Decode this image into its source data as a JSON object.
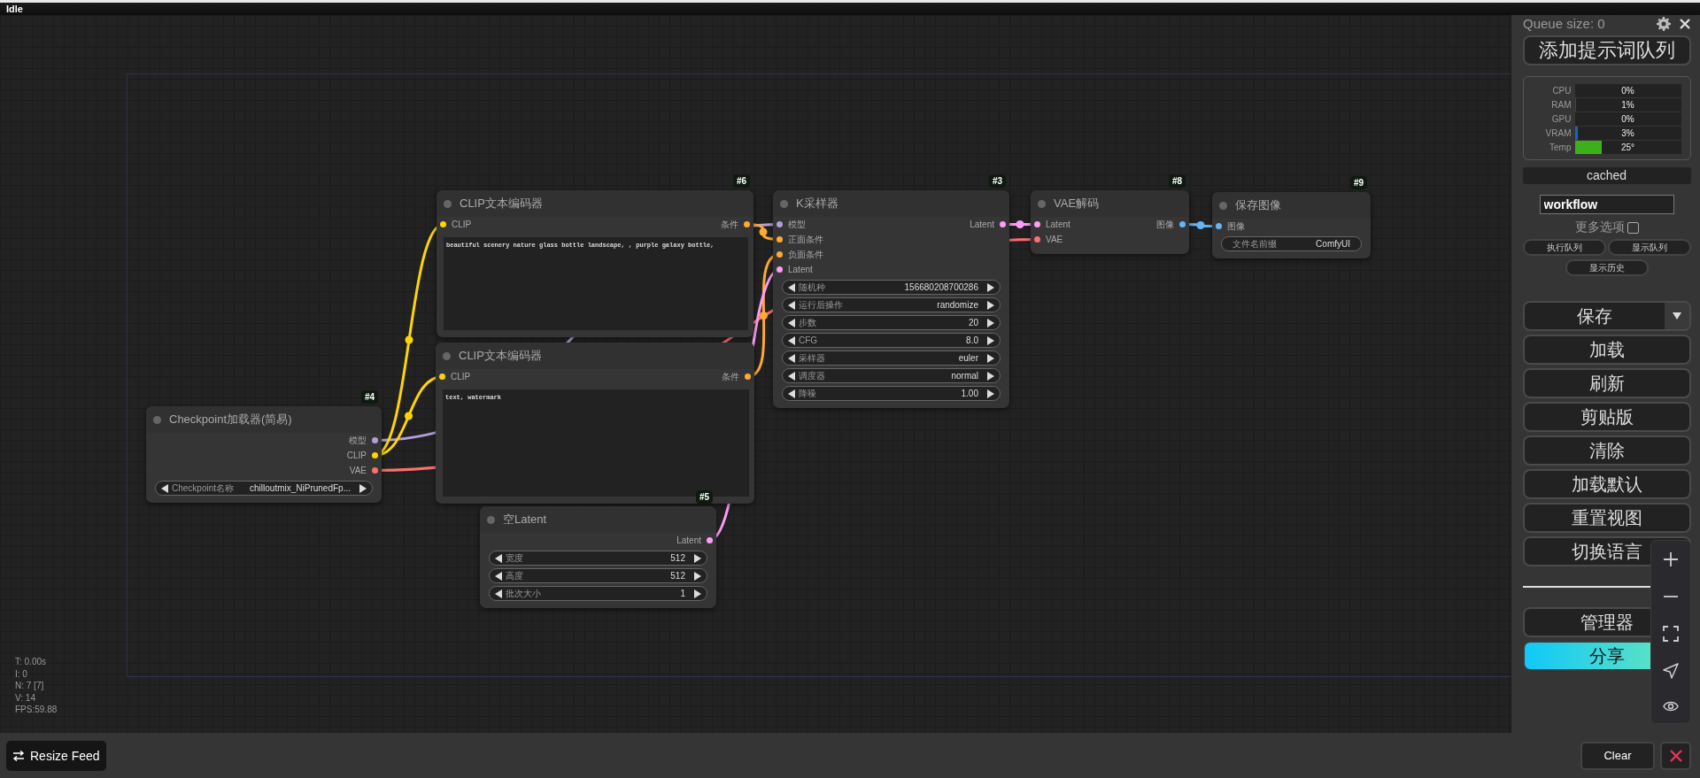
{
  "status": "Idle",
  "nodes": [
    {
      "badge": "#6",
      "title": "CLIP文本编码器",
      "inputs": [
        {
          "label": "CLIP",
          "color": "#ffd500"
        }
      ],
      "outputs": [
        {
          "label": "条件",
          "color": "#ffa931"
        }
      ],
      "text": "beautiful scenery nature glass bottle landscape, , purple galaxy bottle,"
    },
    {
      "badge": "#3",
      "title": "K采样器",
      "inputs": [
        {
          "label": "模型",
          "color": "#b39ddb"
        },
        {
          "label": "正面条件",
          "color": "#ffa931"
        },
        {
          "label": "负面条件",
          "color": "#ffa931"
        },
        {
          "label": "Latent",
          "color": "#ff9cf9"
        }
      ],
      "outputs": [
        {
          "label": "Latent",
          "color": "#ff9cf9"
        }
      ],
      "widgets": [
        {
          "kind": "stepper",
          "label": "随机种",
          "value": "156680208700286"
        },
        {
          "kind": "stepper",
          "label": "运行后操作",
          "value": "randomize"
        },
        {
          "kind": "stepper",
          "label": "步数",
          "value": "20"
        },
        {
          "kind": "stepper",
          "label": "CFG",
          "value": "8.0"
        },
        {
          "kind": "stepper",
          "label": "采样器",
          "value": "euler"
        },
        {
          "kind": "stepper",
          "label": "调度器",
          "value": "normal"
        },
        {
          "kind": "stepper",
          "label": "降噪",
          "value": "1.00"
        }
      ]
    },
    {
      "badge": "#8",
      "title": "VAE解码",
      "inputs": [
        {
          "label": "Latent",
          "color": "#ff9cf9"
        },
        {
          "label": "VAE",
          "color": "#ff6e6e"
        }
      ],
      "outputs": [
        {
          "label": "图像",
          "color": "#64b5f6"
        }
      ]
    },
    {
      "badge": "#9",
      "title": "保存图像",
      "inputs": [
        {
          "label": "图像",
          "color": "#64b5f6"
        }
      ],
      "widgets": [
        {
          "kind": "text",
          "label": "文件名前缀",
          "value": "ComfyUI"
        }
      ]
    },
    {
      "title": "CLIP文本编码器",
      "inputs": [
        {
          "label": "CLIP",
          "color": "#ffd500"
        }
      ],
      "outputs": [
        {
          "label": "条件",
          "color": "#ffa931"
        }
      ],
      "text": "text, watermark"
    },
    {
      "badge": "#4",
      "title": "Checkpoint加载器(简易)",
      "outputs": [
        {
          "label": "模型",
          "color": "#b39ddb"
        },
        {
          "label": "CLIP",
          "color": "#ffd500"
        },
        {
          "label": "VAE",
          "color": "#ff6e6e"
        }
      ],
      "widgets": [
        {
          "kind": "stepper",
          "label": "Checkpoint名称",
          "value": "chilloutmix_NiPrunedFp..."
        }
      ]
    },
    {
      "badge": "#5",
      "title": "空Latent",
      "outputs": [
        {
          "label": "Latent",
          "color": "#ff9cf9"
        }
      ],
      "widgets": [
        {
          "kind": "stepper",
          "label": "宽度",
          "value": "512"
        },
        {
          "kind": "stepper",
          "label": "高度",
          "value": "512"
        },
        {
          "kind": "stepper",
          "label": "批次大小",
          "value": "1"
        }
      ]
    }
  ],
  "canvas_info": [
    "T: 0.00s",
    "I: 0",
    "N: 7 [7]",
    "V: 14",
    "FPS:59.88"
  ],
  "panel": {
    "queue_size": "Queue size: 0",
    "queue_button": "添加提示词队列",
    "monitor": [
      {
        "label": "CPU",
        "value": "0%"
      },
      {
        "label": "RAM",
        "value": "1%",
        "level": 0.01,
        "color": "#0b6b0b"
      },
      {
        "label": "GPU",
        "value": "0%"
      },
      {
        "label": "VRAM",
        "value": "3%",
        "level": 0.03,
        "color": "#1565c0"
      },
      {
        "label": "Temp",
        "value": "25°",
        "level": 0.25,
        "color": "#3cb019"
      }
    ],
    "status": "cached",
    "workflow": "workflow",
    "more_options": {
      "label": "更多选项",
      "checked": false
    },
    "queue_buttons": [
      "执行队列",
      "显示队列"
    ],
    "history_button": "显示历史",
    "actions": [
      {
        "label": "保存",
        "kind": "split"
      },
      {
        "label": "加载",
        "kind": "plain"
      },
      {
        "label": "刷新",
        "kind": "plain"
      },
      {
        "label": "剪贴版",
        "kind": "plain"
      },
      {
        "label": "清除",
        "kind": "plain"
      },
      {
        "label": "加载默认",
        "kind": "plain"
      },
      {
        "label": "重置视图",
        "kind": "plain"
      },
      {
        "label": "切换语言",
        "kind": "plain"
      }
    ],
    "extra_actions": [
      {
        "label": "管理器",
        "kind": "plain"
      },
      {
        "label": "分享",
        "kind": "share"
      }
    ]
  },
  "bottom_bar": {
    "resize_button": "Resize Feed",
    "clear_button": "Clear"
  }
}
